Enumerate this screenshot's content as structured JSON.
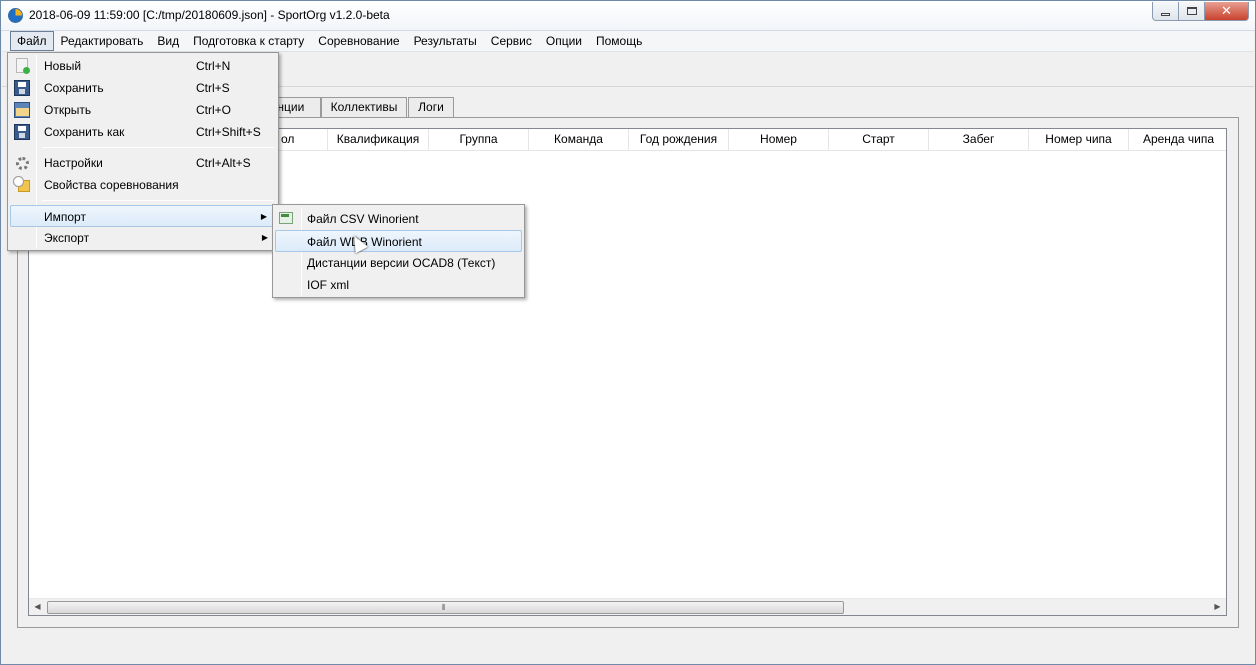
{
  "window": {
    "title": "2018-06-09 11:59:00 [C:/tmp/20180609.json] - SportOrg v1.2.0-beta",
    "controls": {
      "close": "✕"
    }
  },
  "menubar": {
    "items": [
      "Файл",
      "Редактировать",
      "Вид",
      "Подготовка к старту",
      "Соревнование",
      "Результаты",
      "Сервис",
      "Опции",
      "Помощь"
    ],
    "active": "Файл"
  },
  "tabs": {
    "items": [
      "анции",
      "Коллективы",
      "Логи"
    ]
  },
  "table": {
    "columns": [
      "ол",
      "Квалификация",
      "Группа",
      "Команда",
      "Год рождения",
      "Номер",
      "Старт",
      "Забег",
      "Номер чипа",
      "Аренда чипа"
    ],
    "scroll_grip": "⦀"
  },
  "file_menu": {
    "items": [
      {
        "label": "Новый",
        "shortcut": "Ctrl+N",
        "icon": "new-file-icon"
      },
      {
        "label": "Сохранить",
        "shortcut": "Ctrl+S",
        "icon": "save-icon"
      },
      {
        "label": "Открыть",
        "shortcut": "Ctrl+O",
        "icon": "open-folder-icon"
      },
      {
        "label": "Сохранить как",
        "shortcut": "Ctrl+Shift+S",
        "icon": "save-as-icon"
      },
      {
        "label": "Настройки",
        "shortcut": "Ctrl+Alt+S",
        "icon": "gear-icon"
      },
      {
        "label": "Свойства соревнования",
        "shortcut": "",
        "icon": "properties-icon"
      },
      {
        "label": "Импорт",
        "shortcut": "",
        "icon": ""
      },
      {
        "label": "Экспорт",
        "shortcut": "",
        "icon": ""
      }
    ],
    "highlighted": "Импорт"
  },
  "import_submenu": {
    "items": [
      {
        "label": "Файл CSV Winorient",
        "icon": "csv-icon"
      },
      {
        "label": "Файл WDB Winorient",
        "icon": ""
      },
      {
        "label": "Дистанции версии OCAD8 (Текст)",
        "icon": ""
      },
      {
        "label": "IOF xml",
        "icon": ""
      }
    ],
    "highlighted": "Файл WDB Winorient"
  }
}
